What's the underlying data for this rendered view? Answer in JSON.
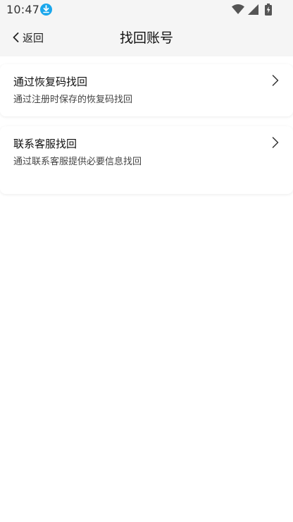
{
  "status_bar": {
    "time": "10:47",
    "icons": [
      "download-icon",
      "wifi-icon",
      "signal-icon",
      "battery-charging-icon"
    ],
    "accent": "#1aa7ec"
  },
  "nav": {
    "back_label": "返回",
    "title": "找回账号"
  },
  "options": [
    {
      "title": "通过恢复码找回",
      "desc": "通过注册时保存的恢复码找回"
    },
    {
      "title": "联系客服找回",
      "desc": "通过联系客服提供必要信息找回"
    }
  ]
}
